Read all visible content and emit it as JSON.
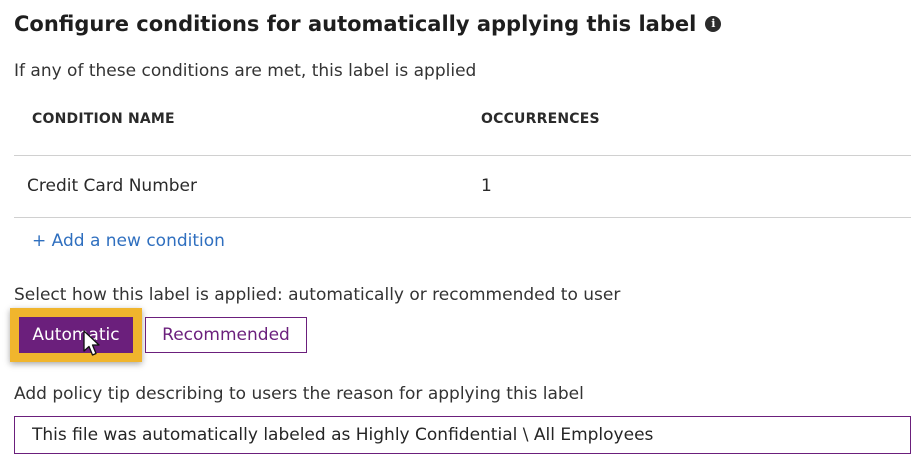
{
  "header": {
    "title": "Configure conditions for automatically applying this label",
    "info_icon": "info-icon",
    "subtitle": "If any of these conditions are met, this label is applied"
  },
  "conditions_table": {
    "columns": [
      "CONDITION NAME",
      "OCCURRENCES"
    ],
    "rows": [
      {
        "name": "Credit Card Number",
        "occurrences": "1"
      }
    ],
    "add_link": "+ Add a new condition"
  },
  "apply_mode": {
    "label": "Select how this label is applied: automatically or recommended to user",
    "options": [
      "Automatic",
      "Recommended"
    ],
    "selected": "Automatic"
  },
  "policy_tip": {
    "label": "Add policy tip describing to users the reason for applying this label",
    "value": "This file was automatically labeled as Highly Confidential \\ All Employees"
  },
  "colors": {
    "accent": "#6b1f7c",
    "link": "#2f6fbf",
    "highlight": "#f0b52d"
  }
}
